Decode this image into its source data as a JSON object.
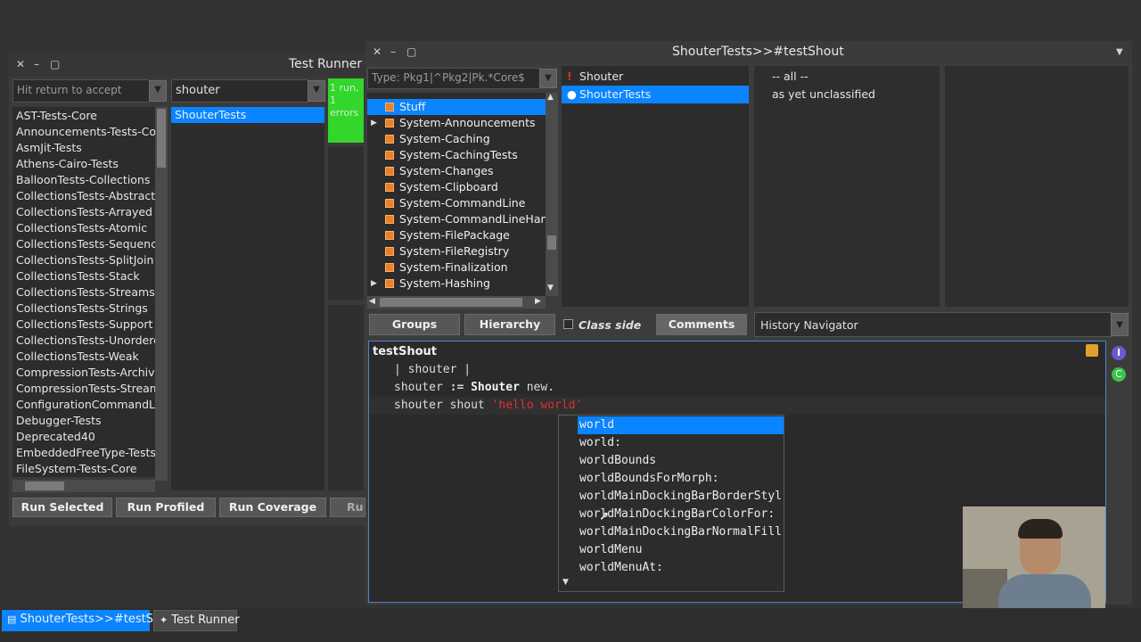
{
  "test_runner": {
    "title": "Test Runner",
    "package_filter": {
      "placeholder": "Hit return to accept"
    },
    "class_filter": {
      "value": "shouter"
    },
    "packages": [
      "AST-Tests-Core",
      "Announcements-Tests-Core",
      "AsmJit-Tests",
      "Athens-Cairo-Tests",
      "BalloonTests-Collections",
      "CollectionsTests-Abstract",
      "CollectionsTests-Arrayed",
      "CollectionsTests-Atomic",
      "CollectionsTests-Sequencea",
      "CollectionsTests-SplitJoin",
      "CollectionsTests-Stack",
      "CollectionsTests-Streams",
      "CollectionsTests-Strings",
      "CollectionsTests-Support",
      "CollectionsTests-Unordered",
      "CollectionsTests-Weak",
      "CompressionTests-Archive",
      "CompressionTests-Streams",
      "ConfigurationCommandLine",
      "Debugger-Tests",
      "Deprecated40",
      "EmbeddedFreeType-Tests",
      "FileSystem-Tests-Core"
    ],
    "classes": [
      "ShouterTests"
    ],
    "status_text": "1 run, 1 errors",
    "buttons": {
      "run_selected": "Run Selected",
      "run_profiled": "Run Profiled",
      "run_coverage": "Run Coverage",
      "run_failures": "Ru"
    }
  },
  "browser": {
    "title": "ShouterTests>>#testShout",
    "package_filter": {
      "placeholder": "Type: Pkg1|^Pkg2|Pk.*Core$"
    },
    "packages": [
      {
        "name": "Stuff",
        "selected": true,
        "expandable": false
      },
      {
        "name": "System-Announcements",
        "selected": false,
        "expandable": true
      },
      {
        "name": "System-Caching",
        "selected": false,
        "expandable": false
      },
      {
        "name": "System-CachingTests",
        "selected": false,
        "expandable": false
      },
      {
        "name": "System-Changes",
        "selected": false,
        "expandable": false
      },
      {
        "name": "System-Clipboard",
        "selected": false,
        "expandable": false
      },
      {
        "name": "System-CommandLine",
        "selected": false,
        "expandable": false
      },
      {
        "name": "System-CommandLineHandl",
        "selected": false,
        "expandable": false
      },
      {
        "name": "System-FilePackage",
        "selected": false,
        "expandable": false
      },
      {
        "name": "System-FileRegistry",
        "selected": false,
        "expandable": false
      },
      {
        "name": "System-Finalization",
        "selected": false,
        "expandable": false
      },
      {
        "name": "System-Hashing",
        "selected": false,
        "expandable": true
      }
    ],
    "classes": [
      {
        "name": "Shouter",
        "icon": "!",
        "selected": false
      },
      {
        "name": "ShouterTests",
        "icon": "●",
        "selected": true
      }
    ],
    "protocols": [
      "-- all --",
      "as yet unclassified"
    ],
    "buttons": {
      "groups": "Groups",
      "hierarchy": "Hierarchy",
      "class_side": "Class side",
      "comments": "Comments"
    },
    "history_navigator": "History Navigator",
    "code": {
      "method_name": "testShout",
      "line2": "| shouter |",
      "line3_var": "shouter",
      "line3_op": ":=",
      "line3_class": "Shouter",
      "line3_msg": "new.",
      "line4_recv": "shouter",
      "line4_msg": "shout",
      "line4_string": "'hello world'"
    },
    "completions": [
      "world",
      "world:",
      "worldBounds",
      "worldBoundsForMorph:",
      "worldMainDockingBarBorderStyl",
      "worldMainDockingBarColorFor:",
      "worldMainDockingBarNormalFill",
      "worldMenu",
      "worldMenuAt:"
    ]
  },
  "taskbar": {
    "items": [
      {
        "label": "ShouterTests>>#testShout",
        "active": true
      },
      {
        "label": "Test Runner",
        "active": false
      }
    ]
  },
  "colors": {
    "accent": "#0a84ff",
    "status_error": "#33d62a",
    "package_icon": "#e8812a",
    "string_literal": "#e03030"
  }
}
